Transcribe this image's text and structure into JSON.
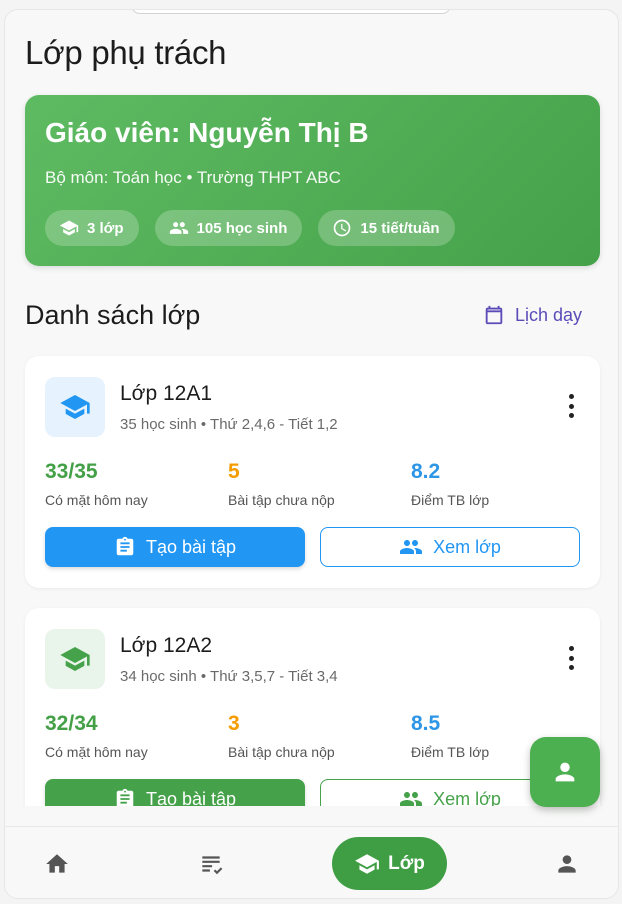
{
  "page": {
    "title": "Lớp phụ trách"
  },
  "hero": {
    "title": "Giáo viên: Nguyễn Thị B",
    "subtitle": "Bộ môn: Toán học • Trường THPT ABC",
    "chips": [
      "3 lớp",
      "105 học sinh",
      "15 tiết/tuần"
    ]
  },
  "section": {
    "title": "Danh sách lớp",
    "schedule_label": "Lịch dạy"
  },
  "classes": [
    {
      "name": "Lớp 12A1",
      "meta": "35 học sinh • Thứ 2,4,6 - Tiết 1,2",
      "accent": "#2196f3",
      "stats": [
        {
          "value": "33/35",
          "label": "Có mặt hôm nay"
        },
        {
          "value": "5",
          "label": "Bài tập chưa nộp"
        },
        {
          "value": "8.2",
          "label": "Điểm TB lớp"
        }
      ],
      "create_label": "Tạo bài tập",
      "view_label": "Xem lớp"
    },
    {
      "name": "Lớp 12A2",
      "meta": "34 học sinh • Thứ 3,5,7 - Tiết 3,4",
      "accent": "#46a24a",
      "stats": [
        {
          "value": "32/34",
          "label": "Có mặt hôm nay"
        },
        {
          "value": "3",
          "label": "Bài tập chưa nộp"
        },
        {
          "value": "8.5",
          "label": "Điểm TB lớp"
        }
      ],
      "create_label": "Tạo bài tập",
      "view_label": "Xem lớp"
    }
  ],
  "nav": {
    "items": [
      "home-icon",
      "assignment-icon",
      "class-icon",
      "profile-icon"
    ],
    "active_label": "Lớp"
  },
  "colors": {
    "green": "#46a24a",
    "blue": "#2196f3",
    "orange": "#f59c00",
    "purple": "#5b4bb8"
  }
}
